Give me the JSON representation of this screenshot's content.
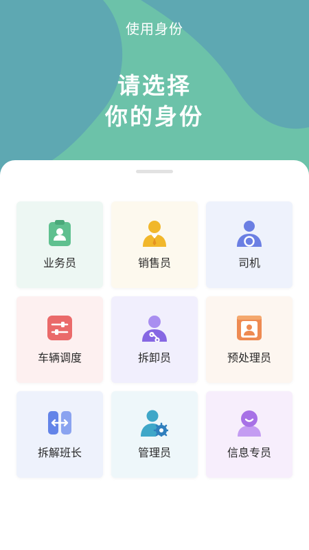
{
  "header": {
    "title": "使用身份",
    "heading_line1": "请选择",
    "heading_line2": "你的身份"
  },
  "roles": [
    {
      "label": "业务员",
      "icon": "clipboard-person-icon",
      "bg": "#edf7f3",
      "accent": "#5fc08f"
    },
    {
      "label": "销售员",
      "icon": "salesperson-icon",
      "bg": "#fdf9ee",
      "accent": "#f1b72b"
    },
    {
      "label": "司机",
      "icon": "driver-icon",
      "bg": "#eef2fc",
      "accent": "#6b7fe3"
    },
    {
      "label": "车辆调度",
      "icon": "sliders-icon",
      "bg": "#fdf0f0",
      "accent": "#ea6a6a"
    },
    {
      "label": "拆卸员",
      "icon": "mechanic-icon",
      "bg": "#f1effd",
      "accent": "#9373e8"
    },
    {
      "label": "预处理员",
      "icon": "profile-book-icon",
      "bg": "#fdf6f0",
      "accent": "#ee8a52"
    },
    {
      "label": "拆解班长",
      "icon": "split-arrows-icon",
      "bg": "#eef2fc",
      "accent": "#6384e8"
    },
    {
      "label": "管理员",
      "icon": "admin-gear-icon",
      "bg": "#eef7fa",
      "accent": "#3fa7c8"
    },
    {
      "label": "信息专员",
      "icon": "smiley-person-icon",
      "bg": "#f7eefc",
      "accent": "#a771e6"
    }
  ]
}
